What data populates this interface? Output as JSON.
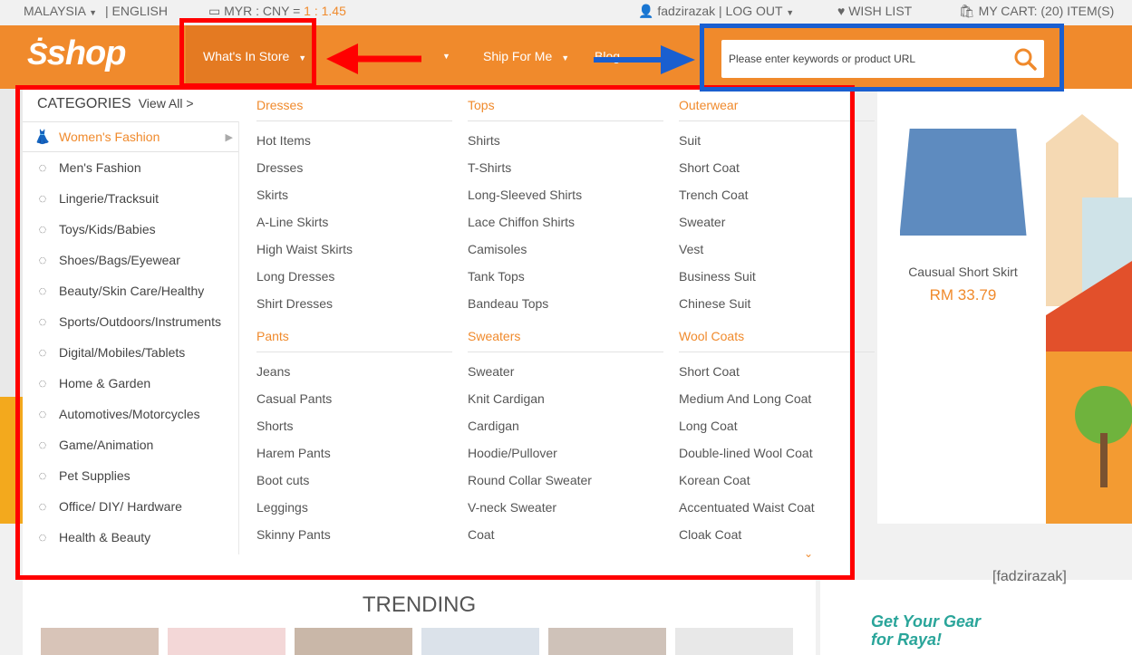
{
  "topbar": {
    "region": "MALAYSIA",
    "language": "| ENGLISH",
    "currency_label": "MYR : CNY =",
    "currency_rate": "1 : 1.45",
    "account": "fadzirazak | LOG OUT",
    "wishlist": "WISH LIST",
    "cart": "MY CART: (20) ITEM(S)"
  },
  "nav": {
    "logo": "shop",
    "items": [
      "What's In Store",
      "Ship For Me",
      "Blog"
    ],
    "search_placeholder": "Please enter keywords or product URL"
  },
  "categories": {
    "title": "CATEGORIES",
    "view_all": "View All >",
    "items": [
      {
        "label": "Women's Fashion",
        "icon": "dress-icon"
      },
      {
        "label": "Men's Fashion",
        "icon": "shirt-icon"
      },
      {
        "label": "Lingerie/Tracksuit",
        "icon": "bra-icon"
      },
      {
        "label": "Toys/Kids/Babies",
        "icon": "baby-clothes-icon"
      },
      {
        "label": "Shoes/Bags/Eyewear",
        "icon": "shoe-icon"
      },
      {
        "label": "Beauty/Skin Care/Healthy",
        "icon": "bottle-icon"
      },
      {
        "label": "Sports/Outdoors/Instruments",
        "icon": "ball-icon"
      },
      {
        "label": "Digital/Mobiles/Tablets",
        "icon": "camera-icon"
      },
      {
        "label": "Home & Garden",
        "icon": "sofa-icon"
      },
      {
        "label": "Automotives/Motorcycles",
        "icon": "car-icon"
      },
      {
        "label": "Game/Animation",
        "icon": "gamepad-icon"
      },
      {
        "label": "Pet Supplies",
        "icon": "bone-icon"
      },
      {
        "label": "Office/ DIY/ Hardware",
        "icon": "cup-icon"
      },
      {
        "label": "Health & Beauty",
        "icon": "health-icon"
      }
    ]
  },
  "columns": [
    {
      "heading": "Dresses",
      "items": [
        "Hot Items",
        "Dresses",
        "Skirts",
        "A-Line Skirts",
        "High Waist Skirts",
        "Long Dresses",
        "Shirt Dresses"
      ]
    },
    {
      "heading": "Tops",
      "items": [
        "Shirts",
        "T-Shirts",
        "Long-Sleeved Shirts",
        "Lace Chiffon Shirts",
        "Camisoles",
        "Tank Tops",
        "Bandeau Tops"
      ]
    },
    {
      "heading": "Outerwear",
      "items": [
        "Suit",
        "Short Coat",
        "Trench Coat",
        "Sweater",
        "Vest",
        "Business Suit",
        "Chinese Suit"
      ]
    },
    {
      "heading": "Pants",
      "items": [
        "Jeans",
        "Casual Pants",
        "Shorts",
        "Harem Pants",
        "Boot cuts",
        "Leggings",
        "Skinny Pants"
      ]
    },
    {
      "heading": "Sweaters",
      "items": [
        "Sweater",
        "Knit Cardigan",
        "Cardigan",
        "Hoodie/Pullover",
        "Round Collar Sweater",
        "V-neck Sweater",
        "Coat"
      ]
    },
    {
      "heading": "Wool Coats",
      "items": [
        "Short Coat",
        "Medium And Long Coat",
        "Long Coat",
        "Double-lined Wool Coat",
        "Korean Coat",
        "Accentuated Waist Coat",
        "Cloak Coat"
      ]
    }
  ],
  "product": {
    "name": "Causual Short Skirt",
    "price": "RM 33.79"
  },
  "trending": {
    "title": "TRENDING"
  },
  "promo": {
    "text_line1": "Get Your Gear",
    "text_line2": "for Raya!",
    "watermark": "[fadzirazak]"
  },
  "colors": {
    "brand": "#f08a2c",
    "annotation_red": "#ff0000",
    "annotation_blue": "#1a5fd0"
  }
}
